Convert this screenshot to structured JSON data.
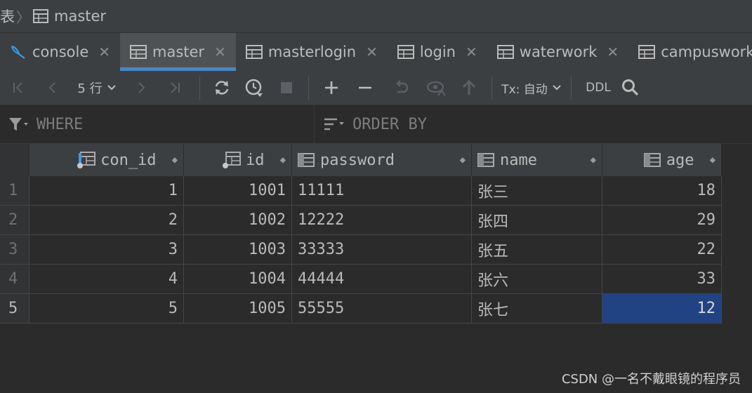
{
  "breadcrumb": {
    "parent": "表",
    "current": "master"
  },
  "tabs": [
    {
      "label": "console",
      "icon": "console-icon",
      "active": false
    },
    {
      "label": "master",
      "icon": "table-icon",
      "active": true
    },
    {
      "label": "masterlogin",
      "icon": "table-icon",
      "active": false
    },
    {
      "label": "login",
      "icon": "table-icon",
      "active": false
    },
    {
      "label": "waterwork",
      "icon": "table-icon",
      "active": false
    },
    {
      "label": "campuswork",
      "icon": "table-icon",
      "active": false
    }
  ],
  "toolbar": {
    "rows_label": "5 行",
    "tx_label": "Tx: 自动",
    "ddl_label": "DDL"
  },
  "filter": {
    "where_placeholder": "WHERE",
    "order_placeholder": "ORDER BY"
  },
  "table": {
    "columns": [
      {
        "label": "con_id",
        "key": true
      },
      {
        "label": "id",
        "key": true
      },
      {
        "label": "password",
        "key": false
      },
      {
        "label": "name",
        "key": false
      },
      {
        "label": "age",
        "key": false
      }
    ],
    "rows": [
      {
        "n": "1",
        "con_id": "1",
        "id": "1001",
        "password": "11111",
        "name": "张三",
        "age": "18"
      },
      {
        "n": "2",
        "con_id": "2",
        "id": "1002",
        "password": "12222",
        "name": "张四",
        "age": "29"
      },
      {
        "n": "3",
        "con_id": "3",
        "id": "1003",
        "password": "33333",
        "name": "张五",
        "age": "22"
      },
      {
        "n": "4",
        "con_id": "4",
        "id": "1004",
        "password": "44444",
        "name": "张六",
        "age": "33"
      },
      {
        "n": "5",
        "con_id": "5",
        "id": "1005",
        "password": "55555",
        "name": "张七",
        "age": "12"
      }
    ],
    "selected_cell": {
      "row": 5,
      "column": "age"
    }
  },
  "watermark": "CSDN @一名不戴眼镜的程序员",
  "colors": {
    "accent": "#4a88c7",
    "selection": "#214283",
    "background": "#2b2b2b"
  }
}
